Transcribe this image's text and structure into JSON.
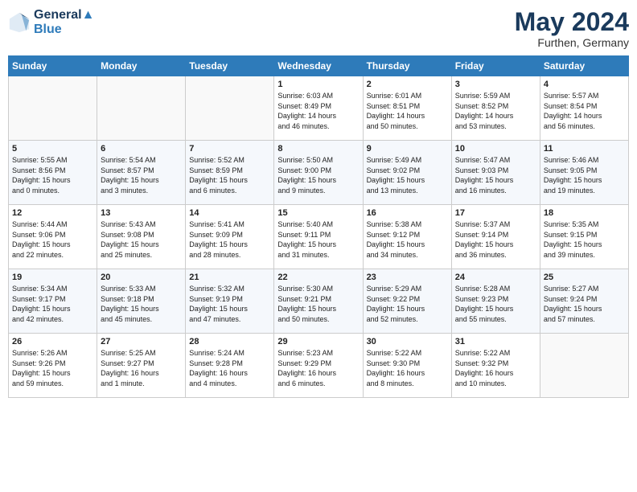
{
  "header": {
    "logo_line1": "General",
    "logo_line2": "Blue",
    "month_title": "May 2024",
    "location": "Furthen, Germany"
  },
  "days_of_week": [
    "Sunday",
    "Monday",
    "Tuesday",
    "Wednesday",
    "Thursday",
    "Friday",
    "Saturday"
  ],
  "weeks": [
    [
      {
        "day": "",
        "info": ""
      },
      {
        "day": "",
        "info": ""
      },
      {
        "day": "",
        "info": ""
      },
      {
        "day": "1",
        "info": "Sunrise: 6:03 AM\nSunset: 8:49 PM\nDaylight: 14 hours\nand 46 minutes."
      },
      {
        "day": "2",
        "info": "Sunrise: 6:01 AM\nSunset: 8:51 PM\nDaylight: 14 hours\nand 50 minutes."
      },
      {
        "day": "3",
        "info": "Sunrise: 5:59 AM\nSunset: 8:52 PM\nDaylight: 14 hours\nand 53 minutes."
      },
      {
        "day": "4",
        "info": "Sunrise: 5:57 AM\nSunset: 8:54 PM\nDaylight: 14 hours\nand 56 minutes."
      }
    ],
    [
      {
        "day": "5",
        "info": "Sunrise: 5:55 AM\nSunset: 8:56 PM\nDaylight: 15 hours\nand 0 minutes."
      },
      {
        "day": "6",
        "info": "Sunrise: 5:54 AM\nSunset: 8:57 PM\nDaylight: 15 hours\nand 3 minutes."
      },
      {
        "day": "7",
        "info": "Sunrise: 5:52 AM\nSunset: 8:59 PM\nDaylight: 15 hours\nand 6 minutes."
      },
      {
        "day": "8",
        "info": "Sunrise: 5:50 AM\nSunset: 9:00 PM\nDaylight: 15 hours\nand 9 minutes."
      },
      {
        "day": "9",
        "info": "Sunrise: 5:49 AM\nSunset: 9:02 PM\nDaylight: 15 hours\nand 13 minutes."
      },
      {
        "day": "10",
        "info": "Sunrise: 5:47 AM\nSunset: 9:03 PM\nDaylight: 15 hours\nand 16 minutes."
      },
      {
        "day": "11",
        "info": "Sunrise: 5:46 AM\nSunset: 9:05 PM\nDaylight: 15 hours\nand 19 minutes."
      }
    ],
    [
      {
        "day": "12",
        "info": "Sunrise: 5:44 AM\nSunset: 9:06 PM\nDaylight: 15 hours\nand 22 minutes."
      },
      {
        "day": "13",
        "info": "Sunrise: 5:43 AM\nSunset: 9:08 PM\nDaylight: 15 hours\nand 25 minutes."
      },
      {
        "day": "14",
        "info": "Sunrise: 5:41 AM\nSunset: 9:09 PM\nDaylight: 15 hours\nand 28 minutes."
      },
      {
        "day": "15",
        "info": "Sunrise: 5:40 AM\nSunset: 9:11 PM\nDaylight: 15 hours\nand 31 minutes."
      },
      {
        "day": "16",
        "info": "Sunrise: 5:38 AM\nSunset: 9:12 PM\nDaylight: 15 hours\nand 34 minutes."
      },
      {
        "day": "17",
        "info": "Sunrise: 5:37 AM\nSunset: 9:14 PM\nDaylight: 15 hours\nand 36 minutes."
      },
      {
        "day": "18",
        "info": "Sunrise: 5:35 AM\nSunset: 9:15 PM\nDaylight: 15 hours\nand 39 minutes."
      }
    ],
    [
      {
        "day": "19",
        "info": "Sunrise: 5:34 AM\nSunset: 9:17 PM\nDaylight: 15 hours\nand 42 minutes."
      },
      {
        "day": "20",
        "info": "Sunrise: 5:33 AM\nSunset: 9:18 PM\nDaylight: 15 hours\nand 45 minutes."
      },
      {
        "day": "21",
        "info": "Sunrise: 5:32 AM\nSunset: 9:19 PM\nDaylight: 15 hours\nand 47 minutes."
      },
      {
        "day": "22",
        "info": "Sunrise: 5:30 AM\nSunset: 9:21 PM\nDaylight: 15 hours\nand 50 minutes."
      },
      {
        "day": "23",
        "info": "Sunrise: 5:29 AM\nSunset: 9:22 PM\nDaylight: 15 hours\nand 52 minutes."
      },
      {
        "day": "24",
        "info": "Sunrise: 5:28 AM\nSunset: 9:23 PM\nDaylight: 15 hours\nand 55 minutes."
      },
      {
        "day": "25",
        "info": "Sunrise: 5:27 AM\nSunset: 9:24 PM\nDaylight: 15 hours\nand 57 minutes."
      }
    ],
    [
      {
        "day": "26",
        "info": "Sunrise: 5:26 AM\nSunset: 9:26 PM\nDaylight: 15 hours\nand 59 minutes."
      },
      {
        "day": "27",
        "info": "Sunrise: 5:25 AM\nSunset: 9:27 PM\nDaylight: 16 hours\nand 1 minute."
      },
      {
        "day": "28",
        "info": "Sunrise: 5:24 AM\nSunset: 9:28 PM\nDaylight: 16 hours\nand 4 minutes."
      },
      {
        "day": "29",
        "info": "Sunrise: 5:23 AM\nSunset: 9:29 PM\nDaylight: 16 hours\nand 6 minutes."
      },
      {
        "day": "30",
        "info": "Sunrise: 5:22 AM\nSunset: 9:30 PM\nDaylight: 16 hours\nand 8 minutes."
      },
      {
        "day": "31",
        "info": "Sunrise: 5:22 AM\nSunset: 9:32 PM\nDaylight: 16 hours\nand 10 minutes."
      },
      {
        "day": "",
        "info": ""
      }
    ]
  ]
}
